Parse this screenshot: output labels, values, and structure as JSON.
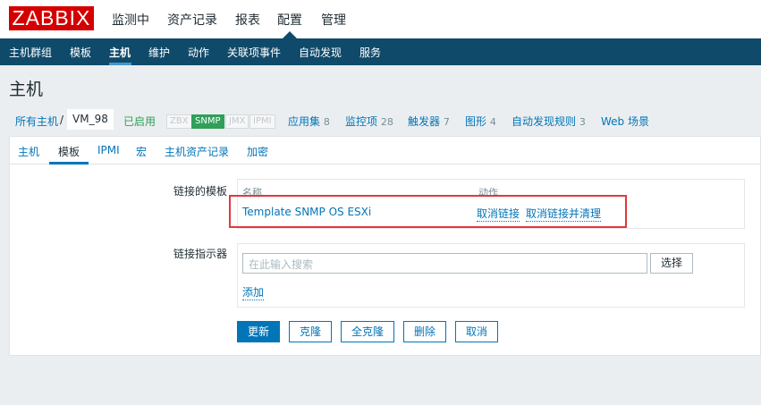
{
  "logo": "ZABBIX",
  "main_menu": [
    "监测中",
    "资产记录",
    "报表",
    "配置",
    "管理"
  ],
  "sub_menu": [
    "主机群组",
    "模板",
    "主机",
    "维护",
    "动作",
    "关联项事件",
    "自动发现",
    "服务"
  ],
  "page_title": "主机",
  "breadcrumb": {
    "all_hosts": "所有主机",
    "sep": "/",
    "host": "VM_98",
    "status": "已启用"
  },
  "availability": [
    "ZBX",
    "SNMP",
    "JMX",
    "IPMI"
  ],
  "colors": {
    "snmp_available": "#2f9f5a",
    "status_enabled": "#2f9f5a",
    "brand": "#d40000",
    "nav": "#0f4a6b"
  },
  "host_links": [
    {
      "label": "应用集",
      "count": "8"
    },
    {
      "label": "监控项",
      "count": "28"
    },
    {
      "label": "触发器",
      "count": "7"
    },
    {
      "label": "图形",
      "count": "4"
    },
    {
      "label": "自动发现规则",
      "count": "3"
    },
    {
      "label": "Web 场景",
      "count": ""
    }
  ],
  "tabs": [
    "主机",
    "模板",
    "IPMI",
    "宏",
    "主机资产记录",
    "加密"
  ],
  "form": {
    "linked_label": "链接的模板",
    "col_name": "名称",
    "col_action": "动作",
    "template": "Template SNMP OS ESXi",
    "unlink": "取消链接",
    "unlink_clear": "取消链接并清理",
    "link_new_label": "链接指示器",
    "search_placeholder": "在此输入搜索",
    "select": "选择",
    "add": "添加"
  },
  "buttons": [
    "更新",
    "克隆",
    "全克隆",
    "删除",
    "取消"
  ]
}
